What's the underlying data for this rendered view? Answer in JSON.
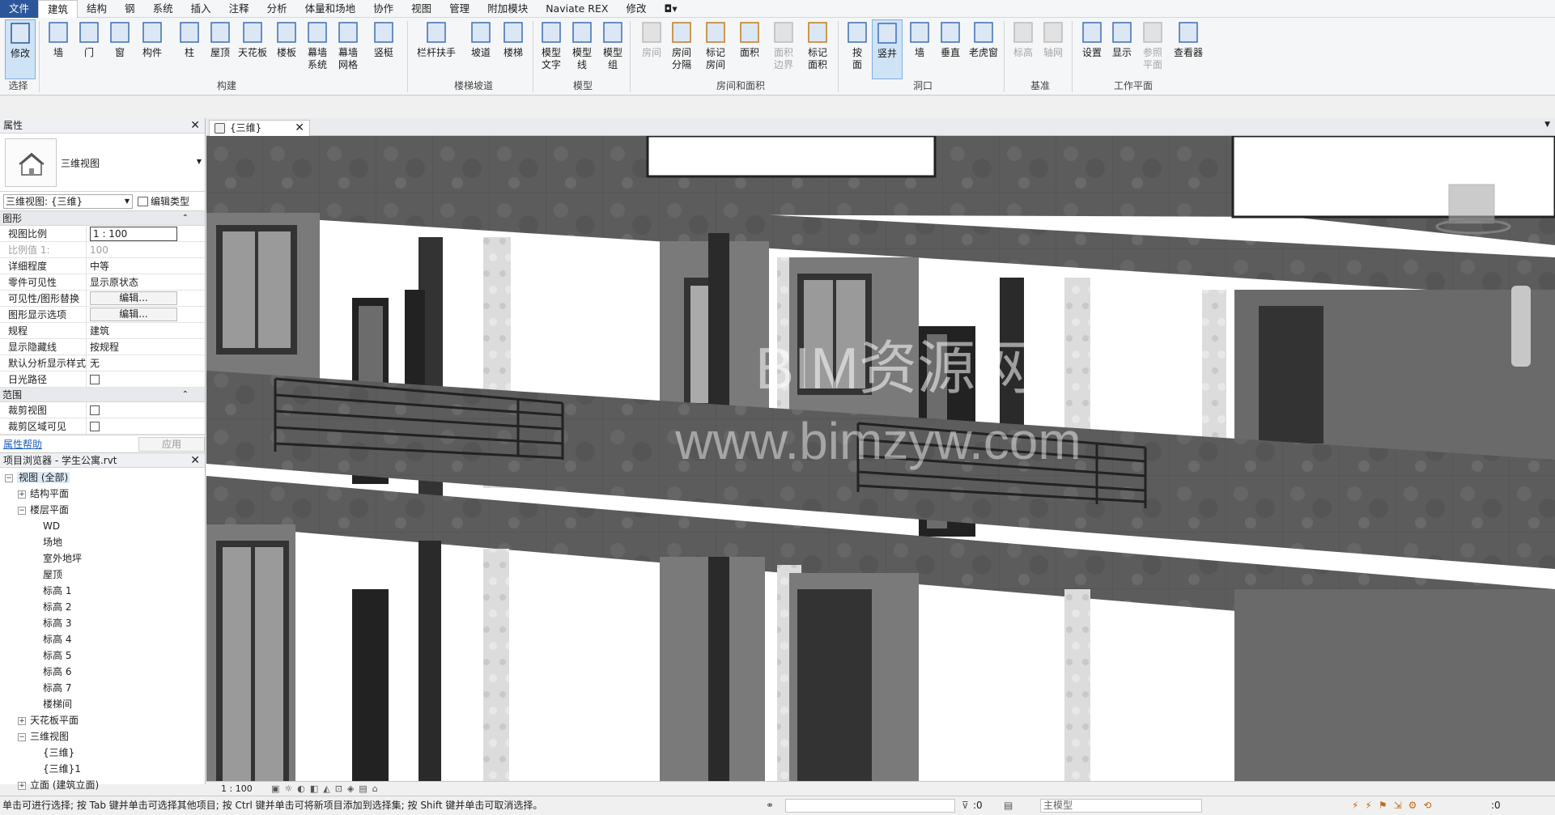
{
  "menu": [
    "文件",
    "建筑",
    "结构",
    "钢",
    "系统",
    "插入",
    "注释",
    "分析",
    "体量和场地",
    "协作",
    "视图",
    "管理",
    "附加模块",
    "Naviate REX",
    "修改"
  ],
  "ribbon": {
    "modify": "修改",
    "select": "选择",
    "build_buttons": [
      "墙",
      "门",
      "窗",
      "构件",
      "柱",
      "屋顶",
      "天花板",
      "楼板",
      "幕墙\n系统",
      "幕墙\n网格",
      "竖梃"
    ],
    "build_label": "构建",
    "stair_buttons": [
      "栏杆扶手",
      "坡道",
      "楼梯"
    ],
    "stair_label": "楼梯坡道",
    "model_buttons": [
      "模型\n文字",
      "模型\n线",
      "模型\n组"
    ],
    "model_label": "模型",
    "room_buttons": [
      "房间",
      "房间\n分隔",
      "标记\n房间",
      "面积",
      "面积\n边界",
      "标记\n面积"
    ],
    "room_label": "房间和面积",
    "opening_buttons": [
      "按\n面",
      "竖井",
      "墙",
      "垂直",
      "老虎窗"
    ],
    "opening_label": "洞口",
    "datum_buttons": [
      "标高",
      "轴网"
    ],
    "datum_label": "基准",
    "wp_buttons": [
      "设置",
      "显示",
      "参照\n平面",
      "查看器"
    ],
    "wp_label": "工作平面"
  },
  "properties": {
    "title": "属性",
    "type_name": "三维视图",
    "selector": "三维视图: {三维}",
    "edit_type": "编辑类型",
    "group_graphics": "图形",
    "rows": [
      {
        "k": "视图比例",
        "v": "1 : 100",
        "kind": "box"
      },
      {
        "k": "比例值 1:",
        "v": "100",
        "kind": "gray"
      },
      {
        "k": "详细程度",
        "v": "中等"
      },
      {
        "k": "零件可见性",
        "v": "显示原状态"
      },
      {
        "k": "可见性/图形替换",
        "v": "编辑...",
        "kind": "btn"
      },
      {
        "k": "图形显示选项",
        "v": "编辑...",
        "kind": "btn"
      },
      {
        "k": "规程",
        "v": "建筑"
      },
      {
        "k": "显示隐藏线",
        "v": "按规程"
      },
      {
        "k": "默认分析显示样式",
        "v": "无"
      },
      {
        "k": "日光路径",
        "v": "",
        "kind": "chk"
      }
    ],
    "group_extent": "范围",
    "extent_rows": [
      {
        "k": "裁剪视图",
        "v": "",
        "kind": "chk"
      },
      {
        "k": "裁剪区域可见",
        "v": "",
        "kind": "chk"
      }
    ],
    "help": "属性帮助",
    "apply": "应用"
  },
  "browser": {
    "title": "项目浏览器 - 学生公寓.rvt",
    "nodes": [
      {
        "t": "视图 (全部)",
        "lvl": 0,
        "tg": "−",
        "hl": true
      },
      {
        "t": "结构平面",
        "lvl": 1,
        "tg": "+"
      },
      {
        "t": "楼层平面",
        "lvl": 1,
        "tg": "−"
      },
      {
        "t": "WD",
        "lvl": 2
      },
      {
        "t": "场地",
        "lvl": 2
      },
      {
        "t": "室外地坪",
        "lvl": 2
      },
      {
        "t": "屋顶",
        "lvl": 2
      },
      {
        "t": "标高 1",
        "lvl": 2
      },
      {
        "t": "标高 2",
        "lvl": 2
      },
      {
        "t": "标高 3",
        "lvl": 2
      },
      {
        "t": "标高 4",
        "lvl": 2
      },
      {
        "t": "标高 5",
        "lvl": 2
      },
      {
        "t": "标高 6",
        "lvl": 2
      },
      {
        "t": "标高 7",
        "lvl": 2
      },
      {
        "t": "楼梯间",
        "lvl": 2
      },
      {
        "t": "天花板平面",
        "lvl": 1,
        "tg": "+"
      },
      {
        "t": "三维视图",
        "lvl": 1,
        "tg": "−"
      },
      {
        "t": "{三维}",
        "lvl": 2
      },
      {
        "t": "{三维}1",
        "lvl": 2
      },
      {
        "t": "立面 (建筑立面)",
        "lvl": 1,
        "tg": "+"
      }
    ]
  },
  "view": {
    "tab": "{三维}",
    "watermark1": "BIM资源网",
    "watermark2": "www.bimzyw.com",
    "scale": "1 : 100"
  },
  "status": {
    "text": "单击可进行选择; 按 Tab 键并单击可选择其他项目; 按 Ctrl 键并单击可将新项目添加到选择集; 按 Shift 键并单击可取消选择。",
    "zero1": ":0",
    "model": "主模型",
    "zero2": ":0"
  }
}
